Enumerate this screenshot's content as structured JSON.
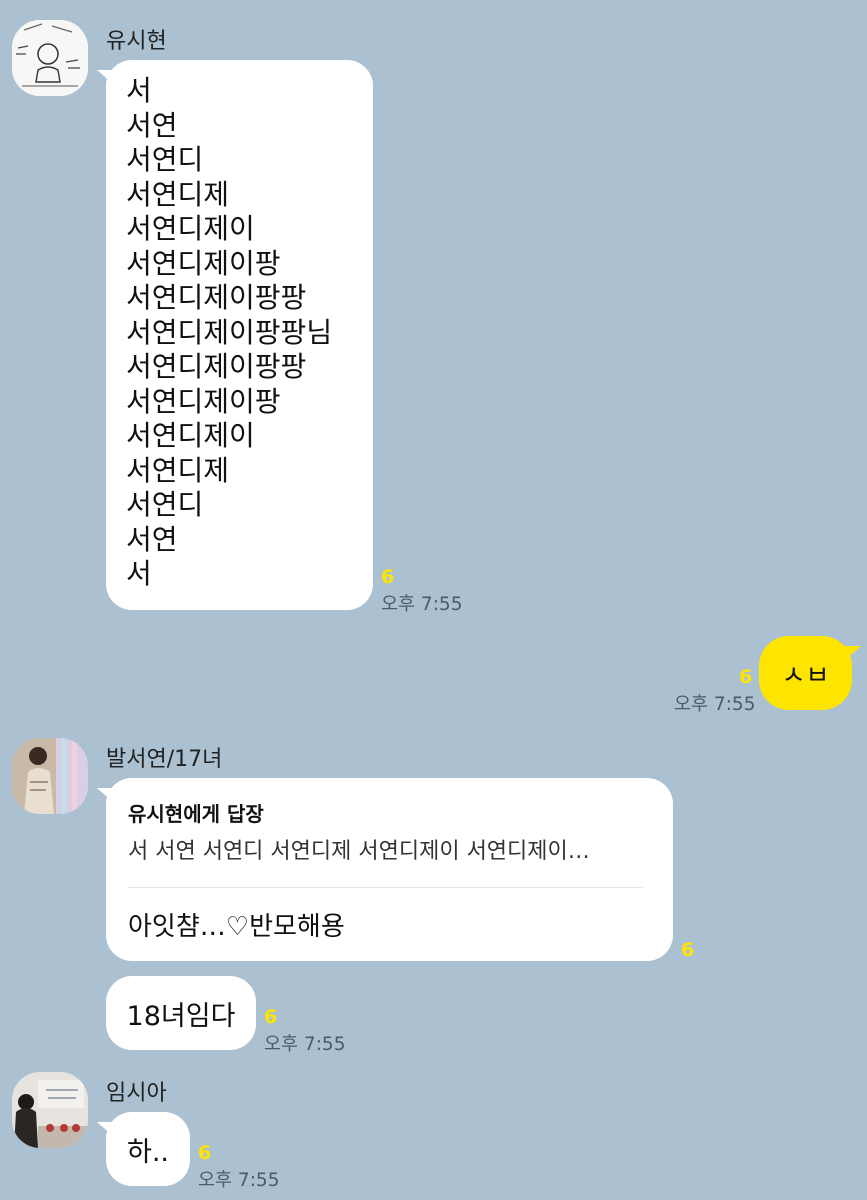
{
  "chat": {
    "messages": [
      {
        "sender": "유시현",
        "lines": [
          "서",
          "서연",
          "서연디",
          "서연디제",
          "서연디제이",
          "서연디제이팡",
          "서연디제이팡팡",
          "서연디제이팡팡님",
          "서연디제이팡팡",
          "서연디제이팡",
          "서연디제이",
          "서연디제",
          "서연디",
          "서연",
          "서"
        ],
        "unread": "6",
        "time": "오후 7:55"
      },
      {
        "sender": "me",
        "text": "ㅅㅂ",
        "unread": "6",
        "time": "오후 7:55"
      },
      {
        "sender": "발서연/17녀",
        "reply_to": "유시현에게 답장",
        "reply_preview": "서 서연 서연디 서연디제 서연디제이 서연디제이…",
        "text": "아잇챰…♡반모해용",
        "unread": "6"
      },
      {
        "text": "18녀임다",
        "unread": "6",
        "time": "오후 7:55"
      },
      {
        "sender": "임시아",
        "text": "하..",
        "unread": "6",
        "time": "오후 7:55"
      }
    ]
  },
  "colors": {
    "background": "#abc1d1",
    "my_bubble": "#fee500",
    "other_bubble": "#ffffff",
    "unread_count": "#ffe400"
  }
}
